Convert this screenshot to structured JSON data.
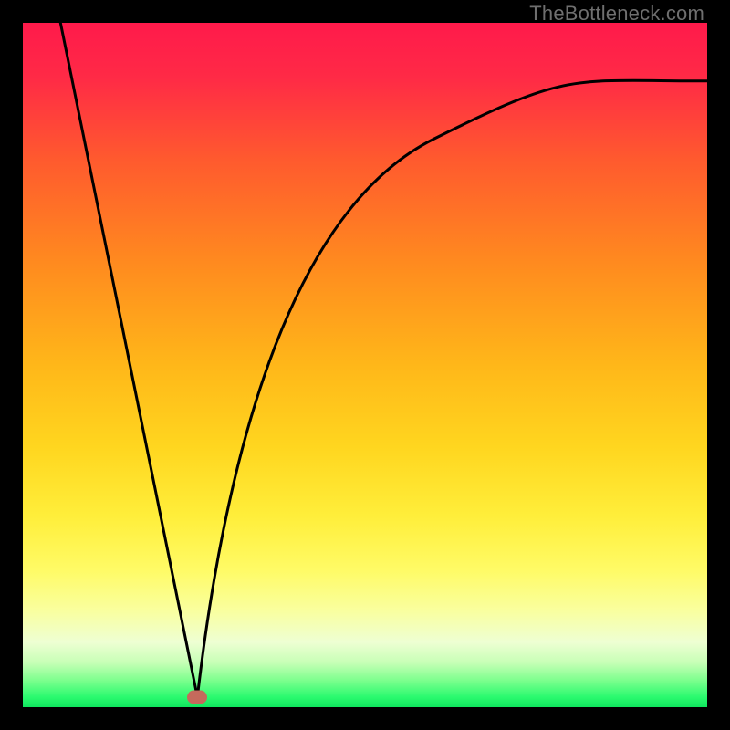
{
  "watermark": "TheBottleneck.com",
  "gradient_stops": [
    {
      "offset": 0.0,
      "color": "#ff1a4b"
    },
    {
      "offset": 0.08,
      "color": "#ff2a46"
    },
    {
      "offset": 0.2,
      "color": "#ff5a2e"
    },
    {
      "offset": 0.35,
      "color": "#ff8a1f"
    },
    {
      "offset": 0.5,
      "color": "#ffb719"
    },
    {
      "offset": 0.62,
      "color": "#ffd61f"
    },
    {
      "offset": 0.72,
      "color": "#ffee3a"
    },
    {
      "offset": 0.8,
      "color": "#fffb66"
    },
    {
      "offset": 0.86,
      "color": "#f9ffa0"
    },
    {
      "offset": 0.905,
      "color": "#eeffd3"
    },
    {
      "offset": 0.935,
      "color": "#c7ffb6"
    },
    {
      "offset": 0.96,
      "color": "#7fff8f"
    },
    {
      "offset": 0.985,
      "color": "#2bfa6f"
    },
    {
      "offset": 1.0,
      "color": "#0fe65e"
    }
  ],
  "marker": {
    "x_frac": 0.255,
    "y_frac": 0.985
  },
  "curve_left": {
    "start": {
      "x": 0.055,
      "y": 0.0
    },
    "end": {
      "x": 0.255,
      "y": 0.985
    }
  },
  "curve_right": {
    "p0": {
      "x": 0.255,
      "y": 0.985
    },
    "c1": {
      "x": 0.3,
      "y": 0.6
    },
    "c2": {
      "x": 0.4,
      "y": 0.27
    },
    "p1": {
      "x": 0.6,
      "y": 0.17
    },
    "c3": {
      "x": 0.8,
      "y": 0.085
    },
    "p2": {
      "x": 1.0,
      "y": 0.085
    }
  },
  "chart_data": {
    "type": "line",
    "title": "",
    "xlabel": "",
    "ylabel": "",
    "ylim": [
      0,
      100
    ],
    "xlim": [
      0,
      100
    ],
    "series": [
      {
        "name": "bottleneck-curve",
        "x": [
          5.5,
          10,
          15,
          20,
          25.5,
          30,
          35,
          40,
          50,
          60,
          70,
          80,
          90,
          100
        ],
        "y": [
          100,
          78,
          53,
          28,
          1.5,
          30,
          52,
          65,
          77,
          83,
          87.5,
          89.5,
          90.8,
          91.5
        ]
      }
    ],
    "optimum_point": {
      "x": 25.5,
      "y": 1.5
    },
    "note": "y is bottleneck percentage; color gradient from red (high) to green (low)"
  }
}
